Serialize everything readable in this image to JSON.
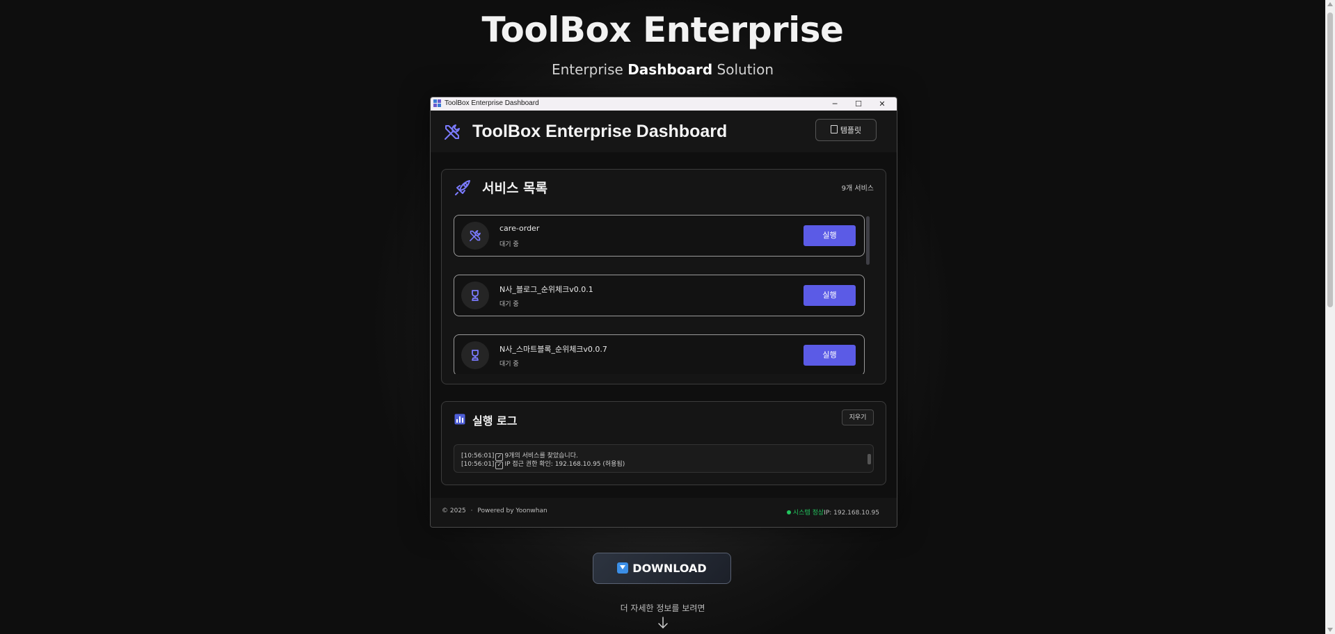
{
  "hero": {
    "title": "ToolBox Enterprise",
    "subtitle_pre": "Enterprise",
    "subtitle_bold": "Dashboard",
    "subtitle_post": "Solution"
  },
  "window": {
    "titlebar_title": "ToolBox Enterprise Dashboard",
    "minimize_glyph": "─",
    "maximize_glyph": "☐",
    "close_glyph": "✕"
  },
  "header": {
    "title": "ToolBox Enterprise Dashboard",
    "template_button": "템플릿",
    "icon": "tools-icon"
  },
  "services": {
    "title": "서비스 목록",
    "count": "9개 서비스",
    "icon": "rocket-icon",
    "items": [
      {
        "name": "care-order",
        "status": "대기 중",
        "run_label": "실행",
        "icon": "tools-icon"
      },
      {
        "name": "N사_블로그_순위체크v0.0.1",
        "status": "대기 중",
        "run_label": "실행",
        "icon": "trophy-icon"
      },
      {
        "name": "N사_스마트블록_순위체크v0.0.7",
        "status": "대기 중",
        "run_label": "실행",
        "icon": "trophy-icon"
      }
    ]
  },
  "log": {
    "title": "실행 로그",
    "clear_button": "지우기",
    "lines": [
      {
        "time": "[10:56:01]",
        "text": "9개의 서비스를 찾았습니다."
      },
      {
        "time": "[10:56:01]",
        "text": "IP 접근 권한 확인: 192.168.10.95 (허용됨)"
      }
    ]
  },
  "footer": {
    "copyright": "© 2025",
    "separator": "·",
    "powered": "Powered by Yoonwhan",
    "status_ok": "시스템 정상",
    "ip": "IP: 192.168.10.95"
  },
  "download": {
    "label": "DOWNLOAD"
  },
  "more": {
    "text": "더 자세한 정보를 보려면",
    "arrow": "↓"
  },
  "colors": {
    "accent": "#5b5be6",
    "status_ok": "#22c55e",
    "download_icon": "#3b8ee6"
  }
}
